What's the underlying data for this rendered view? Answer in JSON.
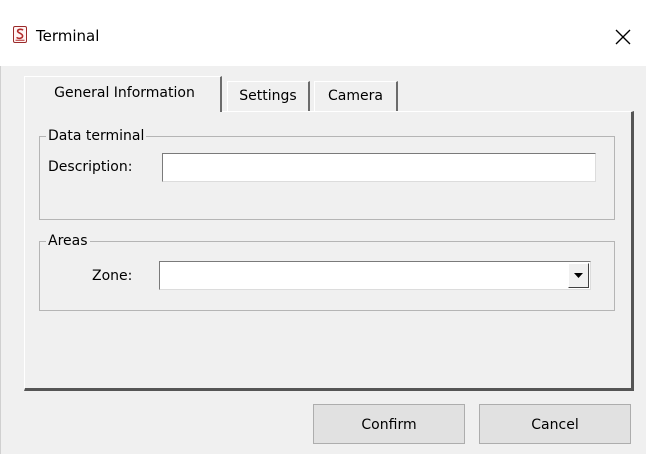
{
  "window": {
    "title": "Terminal",
    "app_icon": "app-logo-icon",
    "close_icon": "close-icon"
  },
  "tabs": [
    {
      "label": "General Information",
      "active": true
    },
    {
      "label": "Settings",
      "active": false
    },
    {
      "label": "Camera",
      "active": false
    }
  ],
  "data_terminal": {
    "legend": "Data terminal",
    "description_label": "Description:",
    "description_value": ""
  },
  "areas": {
    "legend": "Areas",
    "zone_label": "Zone:",
    "zone_value": "",
    "dropdown_icon": "chevron-down-icon"
  },
  "buttons": {
    "confirm": "Confirm",
    "cancel": "Cancel"
  },
  "colors": {
    "window_bg": "#f0f0f0",
    "titlebar_bg": "#ffffff",
    "button_bg": "#e1e1e1",
    "icon_accent": "#9a2a2a"
  }
}
